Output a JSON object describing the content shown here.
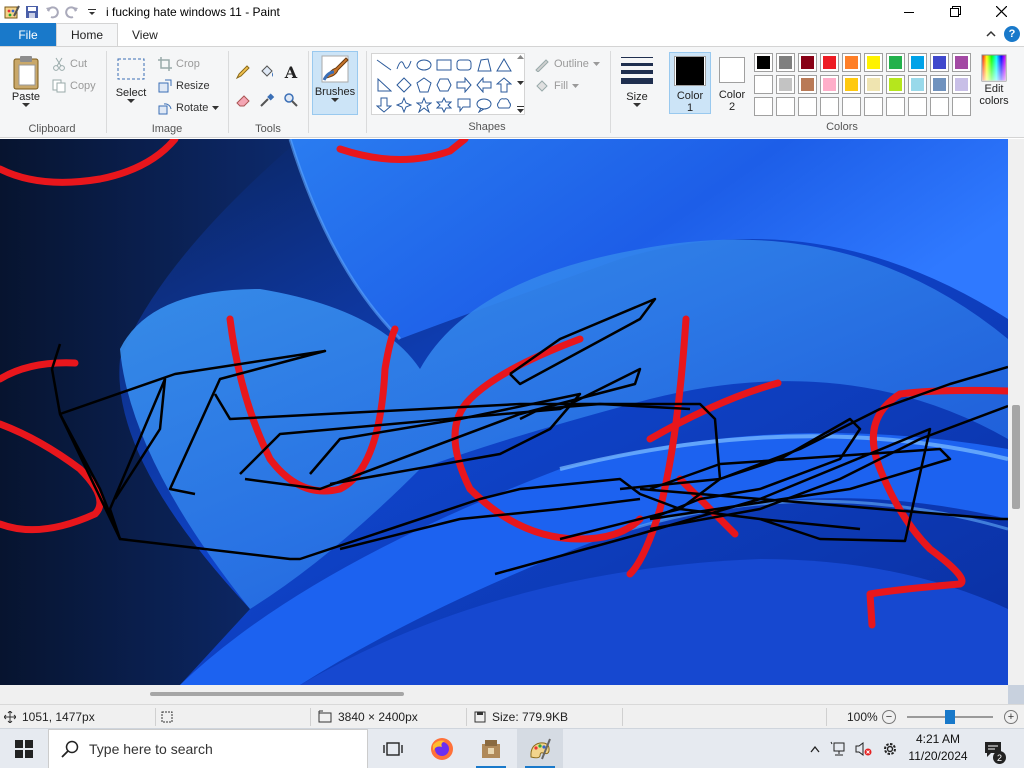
{
  "window": {
    "title": "i fucking hate windows 11 - Paint",
    "controls": [
      "minimize",
      "restore",
      "close"
    ]
  },
  "ribbon_tabs": {
    "file": "File",
    "home": "Home",
    "view": "View"
  },
  "clipboard": {
    "group_label": "Clipboard",
    "paste": "Paste",
    "cut": "Cut",
    "copy": "Copy"
  },
  "image": {
    "group_label": "Image",
    "select": "Select",
    "crop": "Crop",
    "resize": "Resize",
    "rotate": "Rotate"
  },
  "tools": {
    "group_label": "Tools",
    "items": [
      "pencil-icon",
      "fill-bucket-icon",
      "text-icon",
      "eraser-icon",
      "color-picker-icon",
      "magnifier-icon"
    ]
  },
  "brushes": {
    "label": "Brushes"
  },
  "shapes": {
    "group_label": "Shapes",
    "outline": "Outline",
    "fill": "Fill"
  },
  "size": {
    "label": "Size"
  },
  "colors": {
    "group_label": "Colors",
    "color1_label_line1": "Color",
    "color1_label_line2": "1",
    "color2_label_line1": "Color",
    "color2_label_line2": "2",
    "color1": "#000000",
    "color2": "#ffffff",
    "edit_line1": "Edit",
    "edit_line2": "colors",
    "palette_row1": [
      "#000000",
      "#7f7f7f",
      "#880015",
      "#ed1c24",
      "#ff7f27",
      "#fff200",
      "#22b14c",
      "#00a2e8",
      "#3f48cc",
      "#a349a4"
    ],
    "palette_row2": [
      "#ffffff",
      "#c3c3c3",
      "#b97a57",
      "#ffaec9",
      "#ffc90e",
      "#efe4b0",
      "#b5e61d",
      "#99d9ea",
      "#7092be",
      "#c8bfe7"
    ],
    "palette_row3": [
      "#ffffff",
      "#ffffff",
      "#ffffff",
      "#ffffff",
      "#ffffff",
      "#ffffff",
      "#ffffff",
      "#ffffff",
      "#ffffff",
      "#ffffff"
    ]
  },
  "statusbar": {
    "cursor_pos": "1051, 1477px",
    "image_size": "3840 × 2400px",
    "file_size": "Size: 779.9KB",
    "zoom": "100%",
    "zoom_level": 0.5
  },
  "taskbar": {
    "search_placeholder": "Type here to search",
    "apps": [
      "task-view-icon",
      "firefox-icon",
      "file-manager-icon",
      "paint-icon"
    ],
    "time": "4:21 AM",
    "date": "11/20/2024",
    "notification_count": "2"
  }
}
